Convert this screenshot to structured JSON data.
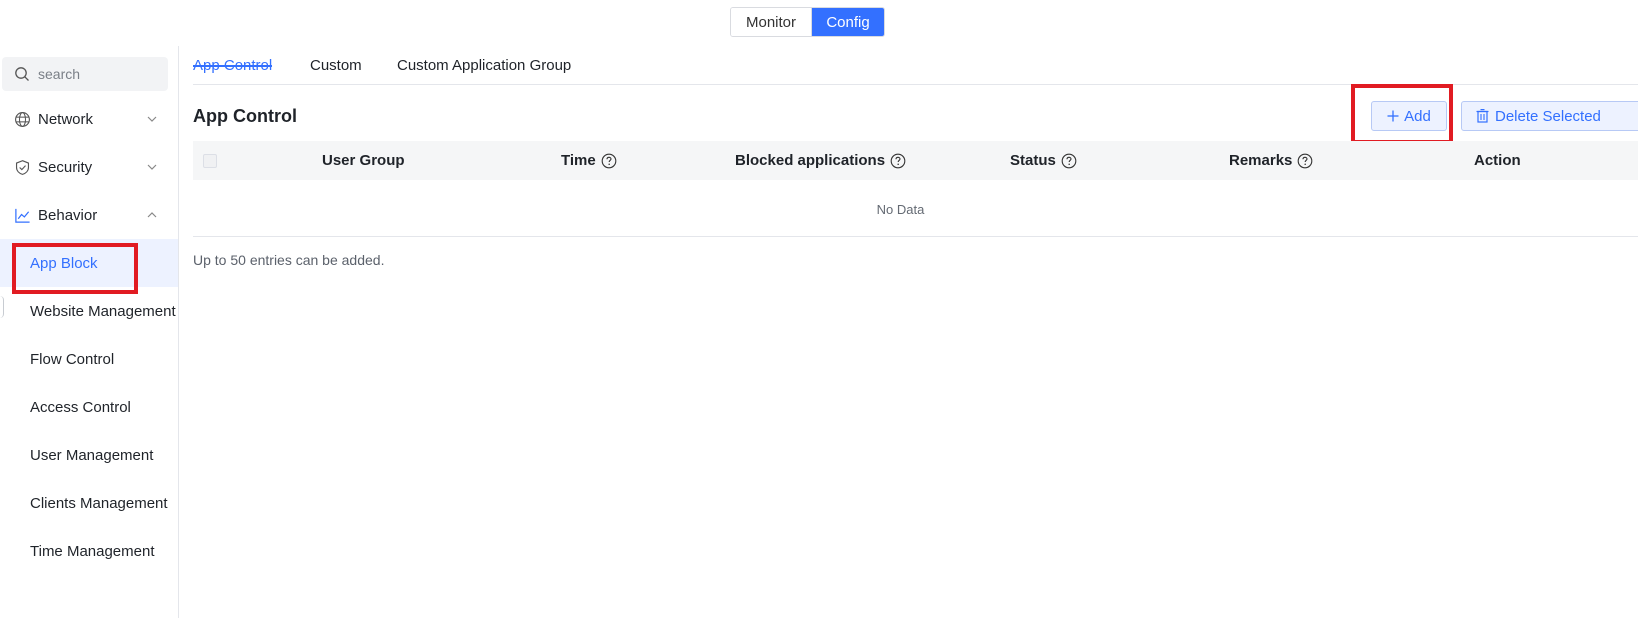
{
  "mode_switch": {
    "monitor": "Monitor",
    "config": "Config"
  },
  "search": {
    "placeholder": "search"
  },
  "sidebar": {
    "groups": [
      {
        "label": "Network",
        "icon": "globe-icon"
      },
      {
        "label": "Security",
        "icon": "shield-icon"
      },
      {
        "label": "Behavior",
        "icon": "chart-line-icon"
      }
    ],
    "behavior_items": [
      {
        "label": "App Block",
        "active": true
      },
      {
        "label": "Website Management"
      },
      {
        "label": "Flow Control"
      },
      {
        "label": "Access Control"
      },
      {
        "label": "User Management"
      },
      {
        "label": "Clients Management"
      },
      {
        "label": "Time Management"
      }
    ]
  },
  "tabs": [
    "App Control",
    "Custom",
    "Custom Application Group"
  ],
  "section": {
    "title": "App Control"
  },
  "toolbar": {
    "add_label": "Add",
    "delete_label": "Delete Selected"
  },
  "table": {
    "columns": [
      "User Group",
      "Time",
      "Blocked applications",
      "Status",
      "Remarks",
      "Action"
    ],
    "empty_text": "No Data"
  },
  "hint": "Up to 50 entries can be added.",
  "colors": {
    "accent": "#3370ff",
    "highlight": "#e11b22",
    "active_bg": "#edf2ff"
  }
}
